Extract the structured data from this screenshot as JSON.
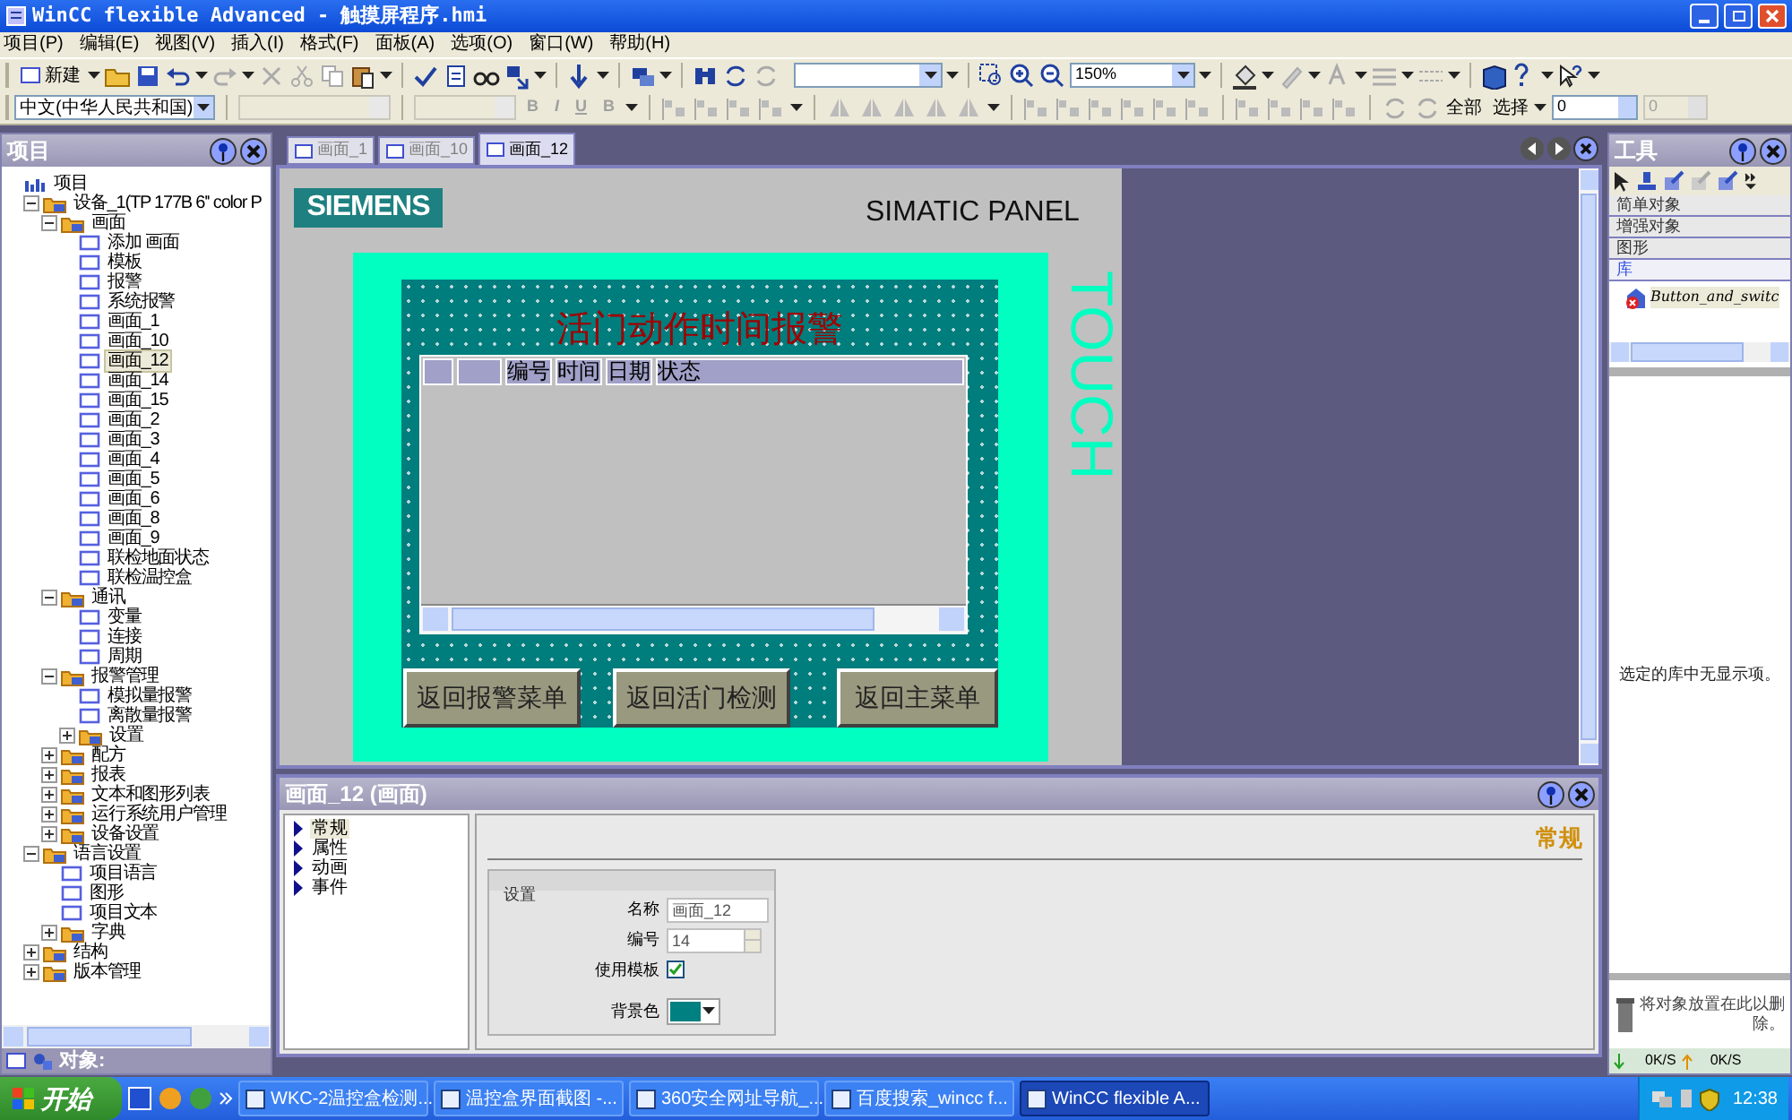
{
  "window": {
    "title": "WinCC flexible Advanced - 触摸屏程序.hmi"
  },
  "menu": [
    "项目(P)",
    "编辑(E)",
    "视图(V)",
    "插入(I)",
    "格式(F)",
    "面板(A)",
    "选项(O)",
    "窗口(W)",
    "帮助(H)"
  ],
  "toolbar": {
    "new_label": "新建",
    "zoom": "150%"
  },
  "format_bar": {
    "language": "中文(中华人民共和国)",
    "style_buttons": [
      "B",
      "I",
      "U",
      "B"
    ],
    "all_label": "全部",
    "select_label": "选择",
    "spin_value": "0",
    "spin_value_disabled": "0"
  },
  "project_panel": {
    "title": "项目",
    "tree": [
      {
        "label": "项目",
        "selected": false,
        "children": [
          {
            "label": "设备_1(TP 177B 6'' color P",
            "selected": false,
            "expanded": true,
            "children": [
              {
                "label": "画面",
                "selected": false,
                "expanded": true,
                "children": [
                  {
                    "label": "添加 画面",
                    "selected": false
                  },
                  {
                    "label": "模板",
                    "selected": false
                  },
                  {
                    "label": "报警",
                    "selected": false
                  },
                  {
                    "label": "系统报警",
                    "selected": false
                  },
                  {
                    "label": "画面_1",
                    "selected": false
                  },
                  {
                    "label": "画面_10",
                    "selected": false
                  },
                  {
                    "label": "画面_12",
                    "selected": true
                  },
                  {
                    "label": "画面_14",
                    "selected": false
                  },
                  {
                    "label": "画面_15",
                    "selected": false
                  },
                  {
                    "label": "画面_2",
                    "selected": false
                  },
                  {
                    "label": "画面_3",
                    "selected": false
                  },
                  {
                    "label": "画面_4",
                    "selected": false
                  },
                  {
                    "label": "画面_5",
                    "selected": false
                  },
                  {
                    "label": "画面_6",
                    "selected": false
                  },
                  {
                    "label": "画面_8",
                    "selected": false
                  },
                  {
                    "label": "画面_9",
                    "selected": false
                  },
                  {
                    "label": "联检地面状态",
                    "selected": false
                  },
                  {
                    "label": "联检温控盒",
                    "selected": false
                  }
                ]
              },
              {
                "label": "通讯",
                "selected": false,
                "expanded": true,
                "children": [
                  {
                    "label": "变量",
                    "selected": false
                  },
                  {
                    "label": "连接",
                    "selected": false
                  },
                  {
                    "label": "周期",
                    "selected": false
                  }
                ]
              },
              {
                "label": "报警管理",
                "selected": false,
                "expanded": true,
                "children": [
                  {
                    "label": "模拟量报警",
                    "selected": false
                  },
                  {
                    "label": "离散量报警",
                    "selected": false
                  },
                  {
                    "label": "设置",
                    "selected": false,
                    "expanded": false
                  }
                ]
              },
              {
                "label": "配方",
                "selected": false,
                "expanded": false
              },
              {
                "label": "报表",
                "selected": false,
                "expanded": false
              },
              {
                "label": "文本和图形列表",
                "selected": false,
                "expanded": false
              },
              {
                "label": "运行系统用户管理",
                "selected": false,
                "expanded": false
              },
              {
                "label": "设备设置",
                "selected": false,
                "expanded": false
              }
            ]
          },
          {
            "label": "语言设置",
            "selected": false,
            "expanded": true,
            "children": [
              {
                "label": "项目语言",
                "selected": false
              },
              {
                "label": "图形",
                "selected": false
              },
              {
                "label": "项目文本",
                "selected": false
              },
              {
                "label": "字典",
                "selected": false,
                "expanded": false
              }
            ]
          },
          {
            "label": "结构",
            "selected": false,
            "expanded": false
          },
          {
            "label": "版本管理",
            "selected": false,
            "expanded": false
          }
        ]
      }
    ]
  },
  "objects_bar": {
    "label": "对象:"
  },
  "editor": {
    "tabs": [
      {
        "label": "画面_1",
        "selected": false
      },
      {
        "label": "画面_10",
        "selected": false
      },
      {
        "label": "画面_12",
        "selected": true
      }
    ],
    "panel": {
      "logo": "SIEMENS",
      "model": "SIMATIC PANEL",
      "side_label": "TOUCH",
      "screen": {
        "title": "活门动作时间报警",
        "columns": [
          "编号",
          "时间",
          "日期",
          "状态"
        ],
        "buttons": [
          "返回报警菜单",
          "返回活门检测",
          "返回主菜单"
        ]
      }
    }
  },
  "properties": {
    "title": "画面_12 (画面)",
    "sections": [
      {
        "label": "常规",
        "selected": true
      },
      {
        "label": "属性",
        "selected": false
      },
      {
        "label": "动画",
        "selected": false
      },
      {
        "label": "事件",
        "selected": false
      }
    ],
    "heading": "常规",
    "group": "设置",
    "name_label": "名称",
    "name_value": "画面_12",
    "number_label": "编号",
    "number_value": "14",
    "template_label": "使用模板",
    "use_template": true,
    "bg_label": "背景色"
  },
  "tools": {
    "title": "工具",
    "categories": [
      {
        "label": "简单对象",
        "selected": false
      },
      {
        "label": "增强对象",
        "selected": false
      },
      {
        "label": "图形",
        "selected": false
      },
      {
        "label": "库",
        "selected": true
      }
    ],
    "library_item": "Button_and_switc",
    "empty_message": "选定的库中无显示项。",
    "delete_hint": "将对象放置在此以删除。",
    "down_rate": "0K/S",
    "up_rate": "0K/S"
  },
  "taskbar": {
    "start": "开始",
    "tasks": [
      {
        "label": "WKC-2温控盒检测...",
        "selected": false
      },
      {
        "label": "温控盒界面截图 -...",
        "selected": false
      },
      {
        "label": "360安全网址导航_...",
        "selected": false
      },
      {
        "label": "百度搜索_wincc f...",
        "selected": false
      },
      {
        "label": "WinCC flexible A...",
        "selected": true
      }
    ],
    "clock": "12:38"
  }
}
